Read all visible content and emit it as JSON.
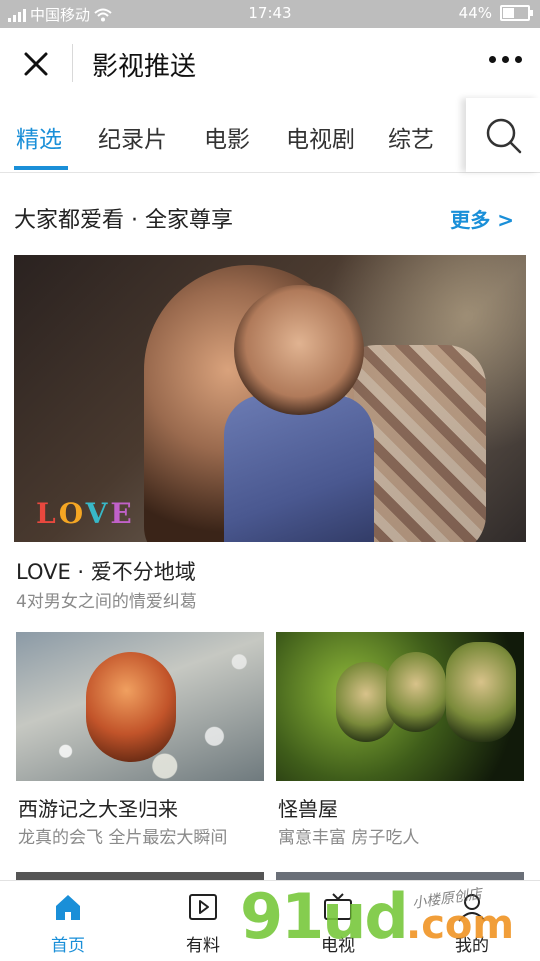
{
  "status_bar": {
    "carrier": "中国移动",
    "time": "17:43",
    "battery": "44%",
    "battery_level": 0.44
  },
  "header": {
    "title": "影视推送"
  },
  "tabs": [
    {
      "label": "精选",
      "active": true
    },
    {
      "label": "纪录片",
      "active": false
    },
    {
      "label": "电影",
      "active": false
    },
    {
      "label": "电视剧",
      "active": false
    },
    {
      "label": "综艺",
      "active": false
    }
  ],
  "section": {
    "title": "大家都爱看 · 全家尊享",
    "more": "更多 >"
  },
  "featured": {
    "logo_text": "LOVE",
    "title": "LOVE · 爱不分地域",
    "subtitle": "4对男女之间的情爱纠葛"
  },
  "cards": [
    {
      "title": "西游记之大圣归来",
      "subtitle": "龙真的会飞 全片最宏大瞬间"
    },
    {
      "title": "怪兽屋",
      "subtitle": "寓意丰富 房子吃人"
    }
  ],
  "bottom_nav": [
    {
      "label": "首页",
      "icon": "home-icon",
      "active": true
    },
    {
      "label": "有料",
      "icon": "play-icon",
      "active": false
    },
    {
      "label": "电视",
      "icon": "tv-icon",
      "active": false
    },
    {
      "label": "我的",
      "icon": "user-icon",
      "active": false
    }
  ],
  "watermark": {
    "main": "91ud",
    "suffix": ".com",
    "tagline": "小楼原创店"
  },
  "colors": {
    "accent": "#1a8fd8",
    "status_bar": "#bdbdbd"
  }
}
